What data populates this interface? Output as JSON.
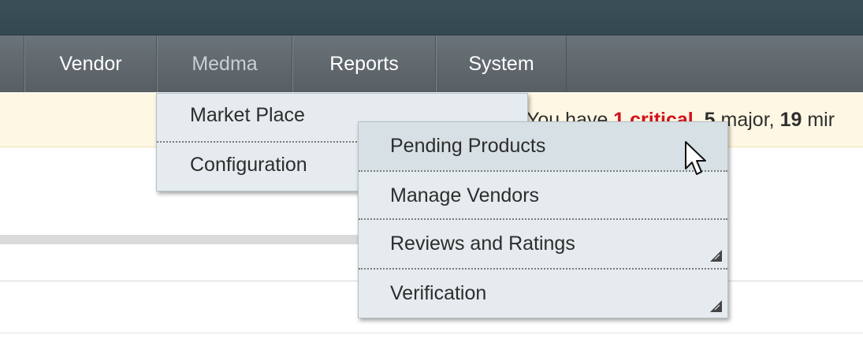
{
  "nav": {
    "items": [
      {
        "label": "Vendor",
        "active": false
      },
      {
        "label": "Medma",
        "active": true
      },
      {
        "label": "Reports",
        "active": false
      },
      {
        "label": "System",
        "active": false
      }
    ]
  },
  "notice": {
    "prefix": "You have ",
    "critical_count": "1",
    "critical_label": " critical",
    "sep1": ", ",
    "major_count": "5",
    "major_label": " major, ",
    "minor_count": "19",
    "minor_label": " mir"
  },
  "menu_medma": {
    "items": [
      {
        "label": "Market Place"
      },
      {
        "label": "Configuration"
      }
    ]
  },
  "menu_marketplace": {
    "items": [
      {
        "label": "Pending Products"
      },
      {
        "label": "Manage Vendors"
      },
      {
        "label": "Reviews and Ratings"
      },
      {
        "label": "Verification"
      }
    ]
  },
  "colors": {
    "topbar": "#344851",
    "navbar": "#5f676c",
    "notice_bg": "#fdf7e3",
    "critical": "#d2121b",
    "menu_bg": "#e5ebee"
  }
}
